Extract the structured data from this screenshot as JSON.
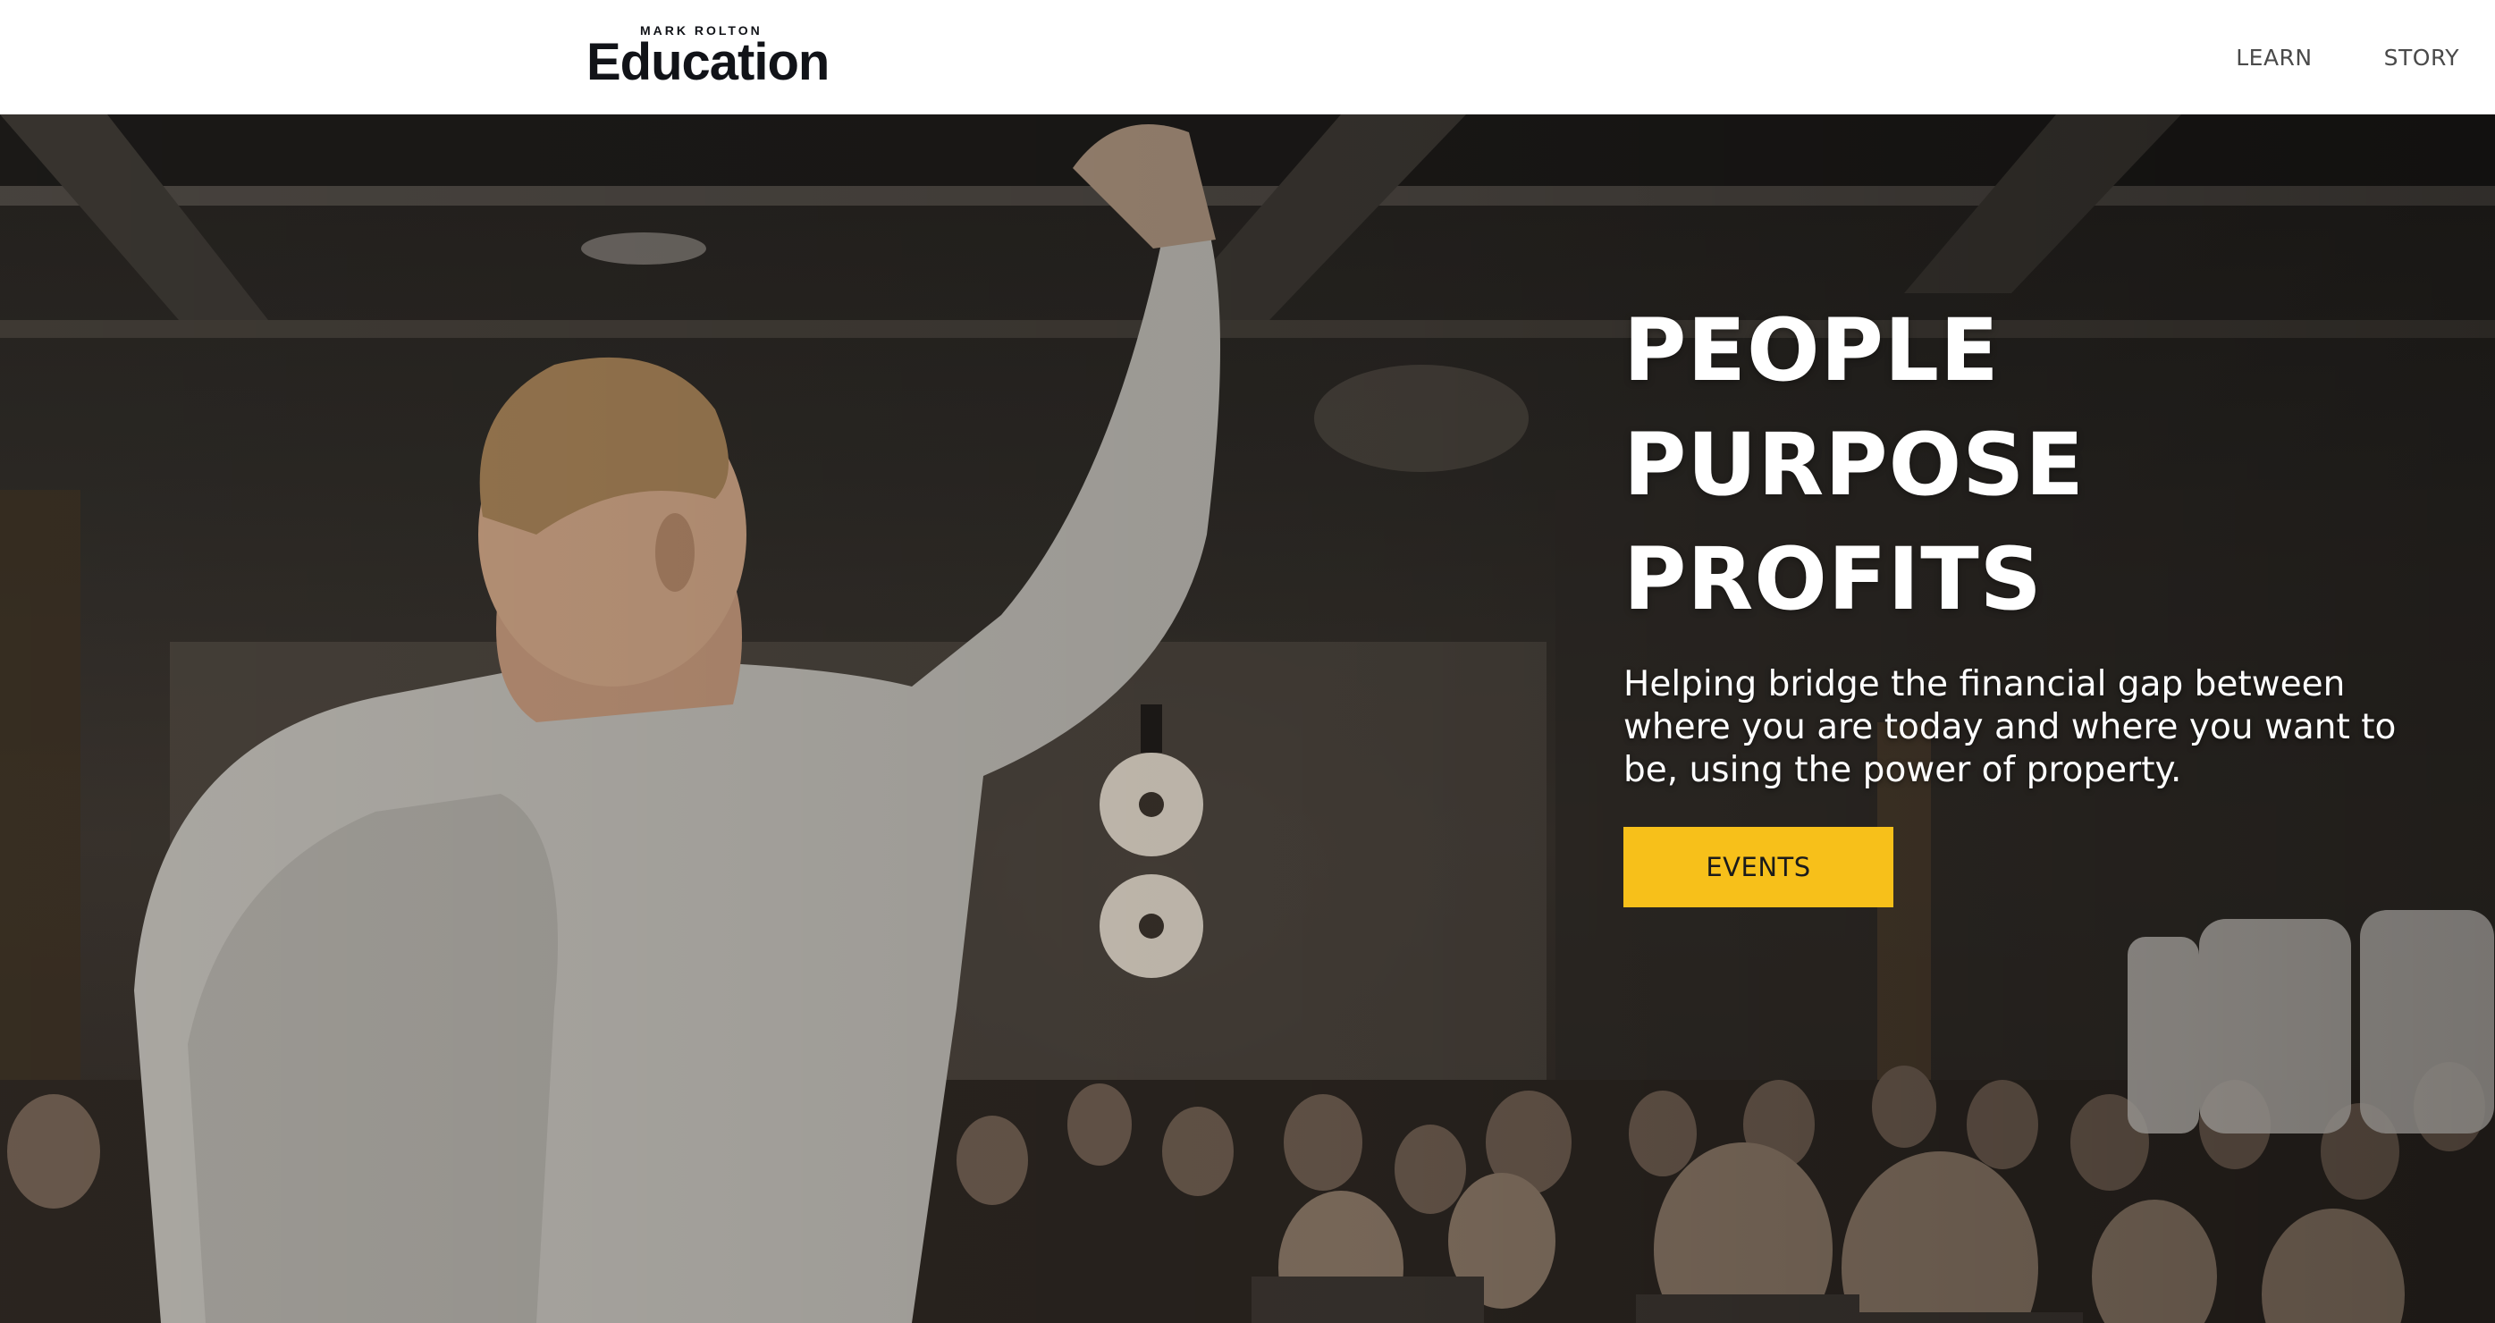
{
  "header": {
    "logo_small": "MARK ROLTON",
    "logo_big": "Education",
    "nav": [
      {
        "label": "LEARN"
      },
      {
        "label": "STORY"
      }
    ]
  },
  "hero": {
    "title_lines": [
      "PEOPLE",
      "PURPOSE",
      "PROFITS"
    ],
    "subtitle": "Helping bridge the financial gap between where you are today and where you want to be, using the power of property.",
    "button_label": "EVENTS",
    "background_image": "speaker with raised arm on stage facing seated audience in a conference hall"
  },
  "colors": {
    "accent": "#f7c01a",
    "header_bg": "#ffffff",
    "logo_text": "#111318",
    "nav_text": "#4a4a4a",
    "hero_text": "#ffffff"
  }
}
